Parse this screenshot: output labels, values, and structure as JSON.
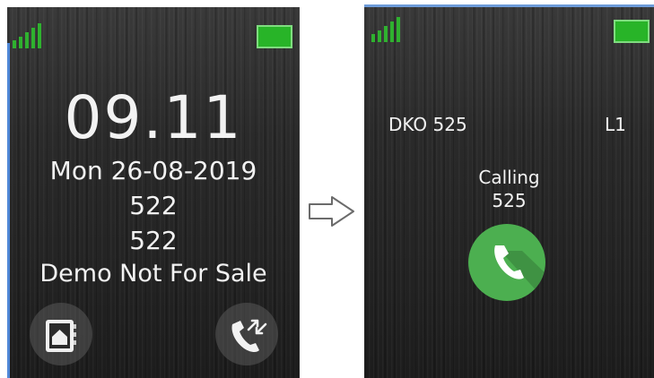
{
  "standby_screen": {
    "time": "09.11",
    "date": "Mon 26-08-2019",
    "line1": "522",
    "line2": "522",
    "line3": "Demo Not For Sale",
    "left_softkey_icon": "phonebook-icon",
    "right_softkey_icon": "call-log-icon"
  },
  "calling_screen": {
    "caller_name": "DKO 525",
    "line_indicator": "L1",
    "status": "Calling",
    "number": "525",
    "call_button_icon": "phone-handset-icon"
  },
  "transition_arrow_icon": "right-arrow-icon",
  "colors": {
    "signal": "#2fb12f",
    "battery": "#28b428",
    "call_button": "#4caf50",
    "text": "#f2f2f2"
  }
}
